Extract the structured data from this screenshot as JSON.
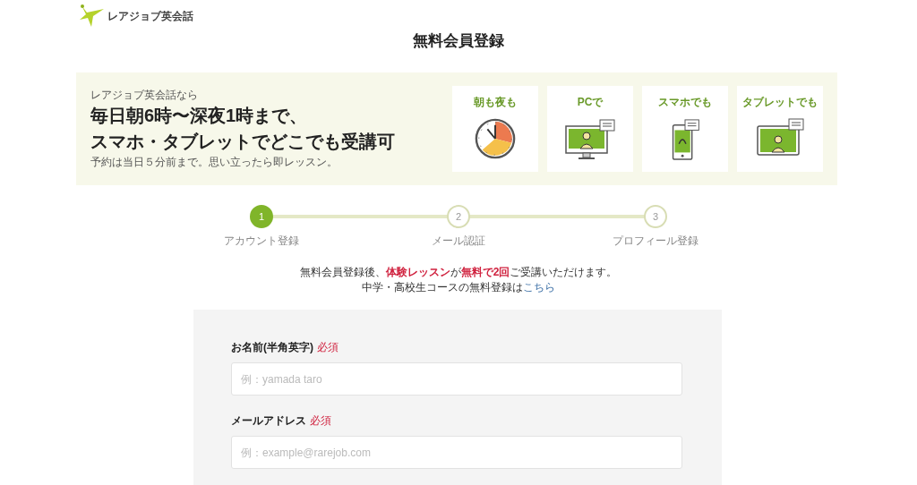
{
  "logo": {
    "text": "レアジョブ英会話"
  },
  "page_title": "無料会員登録",
  "banner": {
    "eyebrow": "レアジョブ英会話なら",
    "headline": [
      "毎日朝6時〜深夜1時まで、",
      "スマホ・タブレットでどこでも受講可"
    ],
    "note": "予約は当日５分前まで。思い立ったら即レッスン。",
    "cards": [
      {
        "label": "朝も夜も",
        "kind": "clock"
      },
      {
        "label": "PCで",
        "kind": "monitor"
      },
      {
        "label": "スマホでも",
        "kind": "phone"
      },
      {
        "label": "タブレットでも",
        "kind": "tablet"
      }
    ]
  },
  "steps": [
    {
      "number": "1",
      "label": "アカウント登録",
      "active": true
    },
    {
      "number": "2",
      "label": "メール認証",
      "active": false
    },
    {
      "number": "3",
      "label": "プロフィール登録",
      "active": false
    }
  ],
  "message": {
    "line": "無料会員登録後、**体験レッスン**が**無料で2回**ご受講いただけます。",
    "junior_text": "中学・高校生コースの無料登録は",
    "junior_link": "こちら"
  },
  "form": {
    "fields": [
      {
        "label": "お名前(半角英字)",
        "required_tag": "必須",
        "required": true,
        "placeholder": "例：yamada taro"
      },
      {
        "label": "メールアドレス",
        "required_tag": "必須",
        "required": true,
        "placeholder": "例：example@rarejob.com"
      }
    ]
  }
}
